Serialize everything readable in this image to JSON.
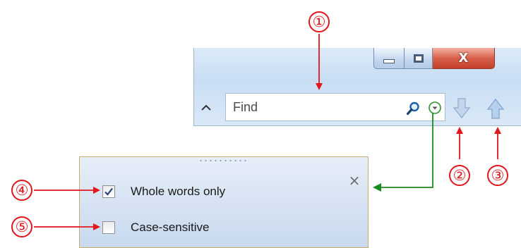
{
  "find_bar": {
    "input_placeholder": "Find",
    "icons": {
      "expand": "chevron-up-icon",
      "search": "magnifier-icon",
      "options": "options-dropdown-icon",
      "next": "arrow-down-icon",
      "previous": "arrow-up-icon"
    }
  },
  "window_controls": {
    "minimize_icon": "minimize-icon",
    "maximize_icon": "maximize-icon",
    "close_glyph": "X"
  },
  "options_popup": {
    "close_glyph": "×",
    "options": [
      {
        "label": "Whole words only",
        "checked": true
      },
      {
        "label": "Case-sensitive",
        "checked": false
      }
    ]
  },
  "callouts": [
    "①",
    "②",
    "③",
    "④",
    "⑤"
  ],
  "colors": {
    "callout_red": "#e0161c",
    "connector_green": "#1e8a1e",
    "popup_border": "#c9ad6a"
  }
}
